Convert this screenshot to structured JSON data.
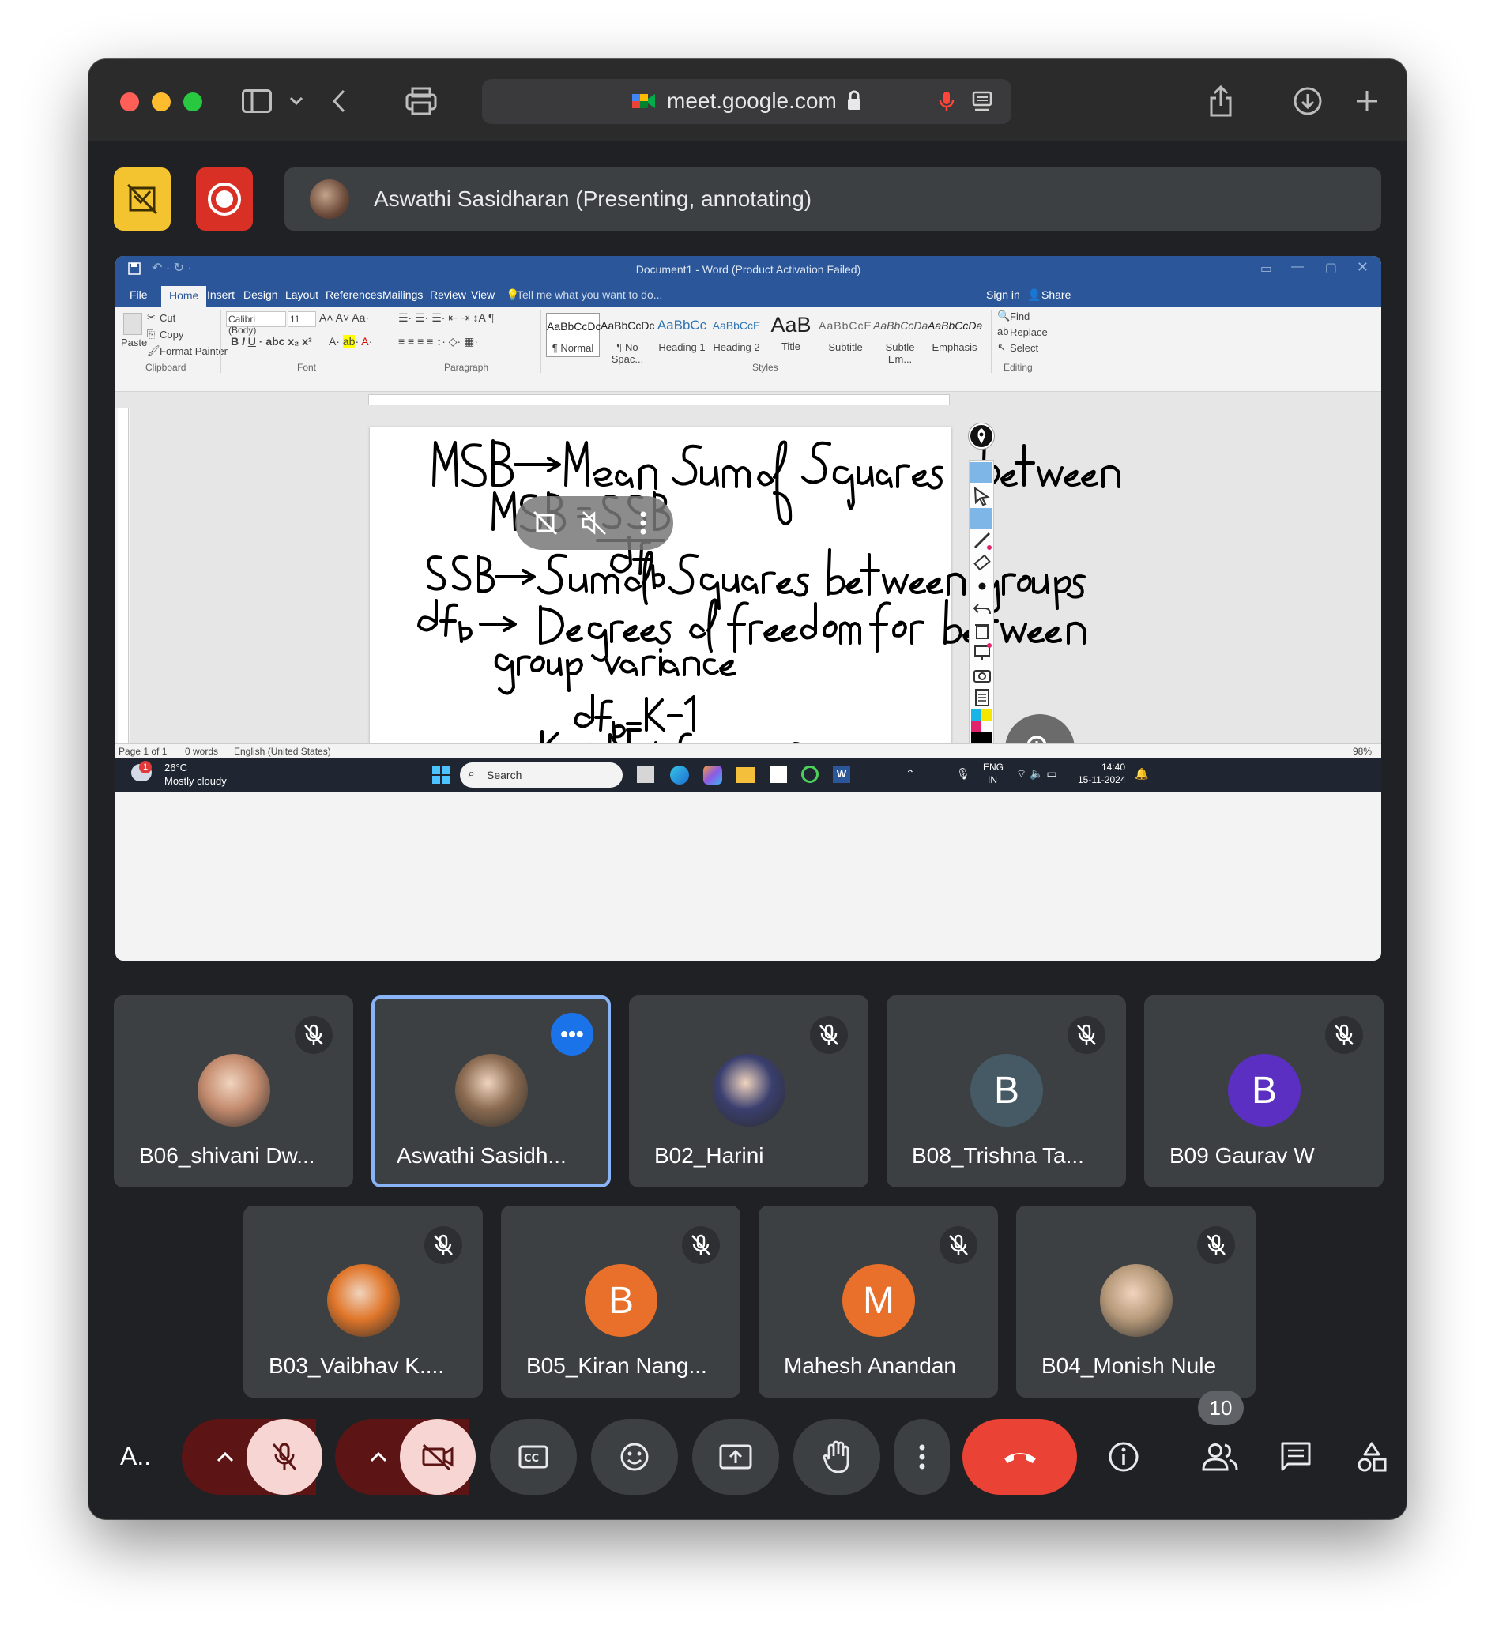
{
  "browser": {
    "url": "meet.google.com"
  },
  "presenter": {
    "label": "Aswathi Sasidharan (Presenting, annotating)"
  },
  "word": {
    "title": "Document1 - Word (Product Activation Failed)",
    "tabs": [
      "File",
      "Home",
      "Insert",
      "Design",
      "Layout",
      "References",
      "Mailings",
      "Review",
      "View"
    ],
    "tell_me": "Tell me what you want to do...",
    "sign_in": "Sign in",
    "share": "Share",
    "clipboard": {
      "paste": "Paste",
      "cut": "Cut",
      "copy": "Copy",
      "format_painter": "Format Painter",
      "group": "Clipboard"
    },
    "font": {
      "name": "Calibri (Body)",
      "size": "11",
      "group": "Font"
    },
    "paragraph_group": "Paragraph",
    "styles": [
      {
        "sample": "AaBbCcDc",
        "name": "¶ Normal"
      },
      {
        "sample": "AaBbCcDc",
        "name": "¶ No Spac..."
      },
      {
        "sample": "AaBbCc",
        "name": "Heading 1"
      },
      {
        "sample": "AaBbCcE",
        "name": "Heading 2"
      },
      {
        "sample": "AaB",
        "name": "Title"
      },
      {
        "sample": "AaBbCcE",
        "name": "Subtitle"
      },
      {
        "sample": "AaBbCcDa",
        "name": "Subtle Em..."
      },
      {
        "sample": "AaBbCcDa",
        "name": "Emphasis"
      }
    ],
    "styles_group": "Styles",
    "editing": {
      "find": "Find",
      "replace": "Replace",
      "select": "Select",
      "group": "Editing"
    },
    "status": {
      "page": "Page 1 of 1",
      "words": "0 words",
      "language": "English (United States)",
      "zoom": "98%"
    }
  },
  "taskbar": {
    "weather_temp": "26°C",
    "weather_desc": "Mostly cloudy",
    "weather_badge": "1",
    "search": "Search",
    "lang1": "ENG",
    "lang2": "IN",
    "time": "14:40",
    "date": "15-11-2024"
  },
  "participants": [
    {
      "name": "B06_shivani Dw...",
      "initial": "",
      "color": "#c48b6e",
      "muted": true
    },
    {
      "name": "Aswathi Sasidh...",
      "initial": "",
      "color": "#8a6a50",
      "muted": false,
      "active": true
    },
    {
      "name": "B02_Harini",
      "initial": "",
      "color": "#3a3f6e",
      "muted": true
    },
    {
      "name": "B08_Trishna Ta...",
      "initial": "B",
      "color": "#455a64",
      "muted": true
    },
    {
      "name": "B09 Gaurav W",
      "initial": "B",
      "color": "#5b2fc2",
      "muted": true
    },
    {
      "name": "B03_Vaibhav K....",
      "initial": "",
      "color": "#e0762a",
      "muted": true
    },
    {
      "name": "B05_Kiran Nang...",
      "initial": "B",
      "color": "#e8702a",
      "muted": true
    },
    {
      "name": "Mahesh Anandan",
      "initial": "M",
      "color": "#e8702a",
      "muted": true
    },
    {
      "name": "B04_Monish Nule",
      "initial": "",
      "color": "#b79a7a",
      "muted": true
    }
  ],
  "controls": {
    "self_label": "A..",
    "people_count": "10"
  },
  "colors": {
    "meet_bg": "#202124",
    "tile_bg": "#3c4043",
    "active_border": "#8ab4f8",
    "end_call": "#ea4335",
    "word_blue": "#2b579a"
  }
}
